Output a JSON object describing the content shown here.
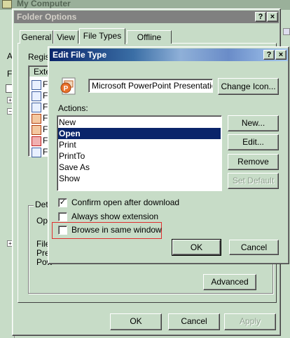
{
  "background_window": {
    "title": "My Computer"
  },
  "folder_options": {
    "title": "Folder Options",
    "tabs": [
      {
        "label": "General"
      },
      {
        "label": "View"
      },
      {
        "label": "File Types"
      },
      {
        "label": "Offline Files"
      }
    ],
    "registered_label": "Regis",
    "list_header": "Exte",
    "row_letters": [
      "F",
      "F",
      "F",
      "F",
      "F",
      "F",
      "F"
    ],
    "details_label": "Det",
    "opens_label": "Ope",
    "file_lines": [
      "File",
      "Pre",
      "Pow"
    ],
    "advanced_label": "Advanced",
    "ok_label": "OK",
    "cancel_label": "Cancel",
    "apply_label": "Apply"
  },
  "edit_file_type": {
    "title": "Edit File Type",
    "description_value": "Microsoft PowerPoint Presentation",
    "change_icon_label": "Change Icon...",
    "actions_label": "Actions:",
    "actions": [
      {
        "label": "New",
        "selected": false
      },
      {
        "label": "Open",
        "selected": true
      },
      {
        "label": "Print",
        "selected": false
      },
      {
        "label": "PrintTo",
        "selected": false
      },
      {
        "label": "Save As",
        "selected": false
      },
      {
        "label": "Show",
        "selected": false
      }
    ],
    "new_label": "New...",
    "edit_label": "Edit...",
    "remove_label": "Remove",
    "set_default_label": "Set Default",
    "confirm_open_label": "Confirm open after download",
    "confirm_open_checked": true,
    "always_show_label": "Always show extension",
    "always_show_checked": false,
    "browse_same_label": "Browse in same window",
    "browse_same_checked": false,
    "ok_label": "OK",
    "cancel_label": "Cancel",
    "help_glyph": "?",
    "close_glyph": "×"
  },
  "colors": {
    "dialog_face": "#c7dcc7",
    "active_title_start": "#0a246a",
    "active_title_end": "#a6caf0",
    "inactive_title": "#808080",
    "highlight": "#0a246a",
    "annotation": "#e03030"
  }
}
